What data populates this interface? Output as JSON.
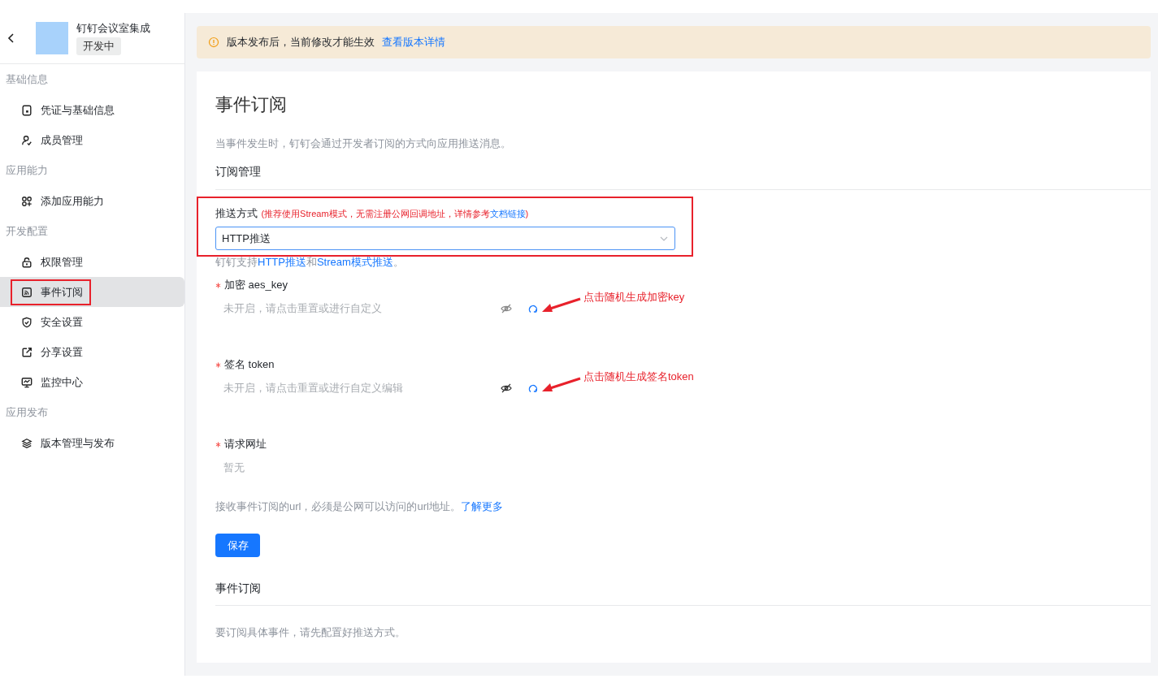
{
  "app": {
    "name": "钉钉会议室集成",
    "status": "开发中"
  },
  "sidebar": {
    "groups": [
      {
        "title": "基础信息",
        "items": [
          {
            "label": "凭证与基础信息",
            "selected": false,
            "marked": false
          },
          {
            "label": "成员管理",
            "selected": false,
            "marked": false
          }
        ]
      },
      {
        "title": "应用能力",
        "items": [
          {
            "label": "添加应用能力",
            "selected": false,
            "marked": false
          }
        ]
      },
      {
        "title": "开发配置",
        "items": [
          {
            "label": "权限管理",
            "selected": false,
            "marked": false
          },
          {
            "label": "事件订阅",
            "selected": true,
            "marked": true
          },
          {
            "label": "安全设置",
            "selected": false,
            "marked": false
          },
          {
            "label": "分享设置",
            "selected": false,
            "marked": false
          },
          {
            "label": "监控中心",
            "selected": false,
            "marked": false
          }
        ]
      },
      {
        "title": "应用发布",
        "items": [
          {
            "label": "版本管理与发布",
            "selected": false,
            "marked": false
          }
        ]
      }
    ]
  },
  "notice": {
    "text": "版本发布后，当前修改才能生效",
    "link": "查看版本详情"
  },
  "page": {
    "title": "事件订阅",
    "description": "当事件发生时，钉钉会通过开发者订阅的方式向应用推送消息。",
    "section_title": "订阅管理"
  },
  "push_mode": {
    "label": "推送方式",
    "marked": true,
    "hint": "(推荐使用Stream模式，无需注册公网回调地址，详情参考",
    "hint_link": "文档链接",
    "hint_end": ")",
    "value": "HTTP推送",
    "support": [
      {
        "kind": "text",
        "text": "钉钉支持"
      },
      {
        "kind": "link",
        "text": "HTTP推送"
      },
      {
        "kind": "text",
        "text": "和"
      },
      {
        "kind": "link",
        "text": "Stream模式推送"
      },
      {
        "kind": "text",
        "text": "。"
      }
    ]
  },
  "fields": [
    {
      "kind": "secret",
      "label": "加密 aes_key",
      "required": true,
      "text": "未开启，请点击重置或进行自定义",
      "annotation": "点击随机生成加密key"
    },
    {
      "kind": "secret",
      "label": "签名 token",
      "required": true,
      "text": "未开启，请点击重置或进行自定义编辑",
      "annotation": "点击随机生成签名token"
    },
    {
      "kind": "plain",
      "label": "请求网址",
      "required": true,
      "text": "暂无"
    }
  ],
  "url_help": {
    "text": "接收事件订阅的url，必须是公网可以访问的url地址。",
    "link": "了解更多"
  },
  "save_button": "保存",
  "events": {
    "title": "事件订阅",
    "note": "要订阅具体事件，请先配置好推送方式。"
  }
}
